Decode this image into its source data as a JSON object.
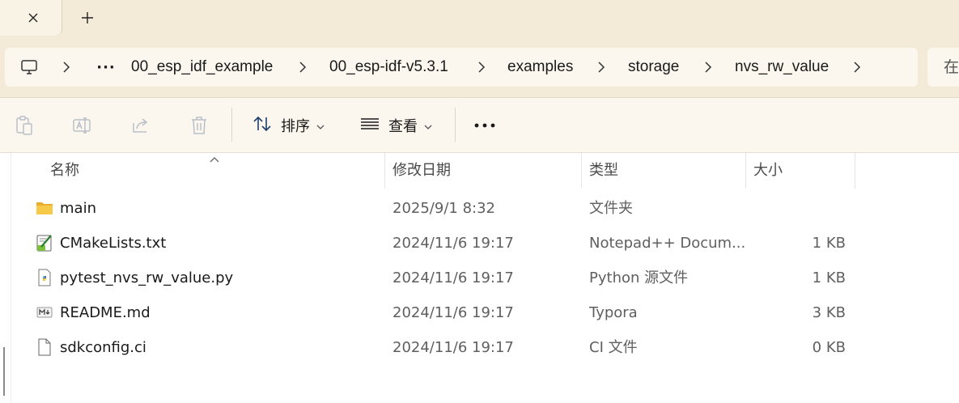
{
  "tabs": {
    "close_icon": "close-icon",
    "new_tab_icon": "plus-icon"
  },
  "address": {
    "root_icon": "computer-icon",
    "overflow": "···",
    "crumbs": [
      "00_esp_idf_example",
      "00_esp-idf-v5.3.1",
      "examples",
      "storage",
      "nvs_rw_value"
    ]
  },
  "search": {
    "placeholder": "在"
  },
  "toolbar": {
    "sort_label": "排序",
    "view_label": "查看",
    "icons": [
      "paste-icon",
      "rename-icon",
      "share-icon",
      "delete-icon"
    ]
  },
  "columns": {
    "name": "名称",
    "date": "修改日期",
    "type": "类型",
    "size": "大小"
  },
  "files": [
    {
      "name": "main",
      "date": "2025/9/1 8:32",
      "type": "文件夹",
      "size": "",
      "icon": "folder-icon"
    },
    {
      "name": "CMakeLists.txt",
      "date": "2024/11/6 19:17",
      "type": "Notepad++ Docum...",
      "size": "1 KB",
      "icon": "notepad-file-icon"
    },
    {
      "name": "pytest_nvs_rw_value.py",
      "date": "2024/11/6 19:17",
      "type": "Python 源文件",
      "size": "1 KB",
      "icon": "python-file-icon"
    },
    {
      "name": "README.md",
      "date": "2024/11/6 19:17",
      "type": "Typora",
      "size": "3 KB",
      "icon": "markdown-file-icon"
    },
    {
      "name": "sdkconfig.ci",
      "date": "2024/11/6 19:17",
      "type": "CI 文件",
      "size": "0 KB",
      "icon": "generic-file-icon"
    }
  ],
  "colors": {
    "chrome": "#f3ead7",
    "toolbar": "#fbf7ee",
    "folder": "#f5c342"
  }
}
